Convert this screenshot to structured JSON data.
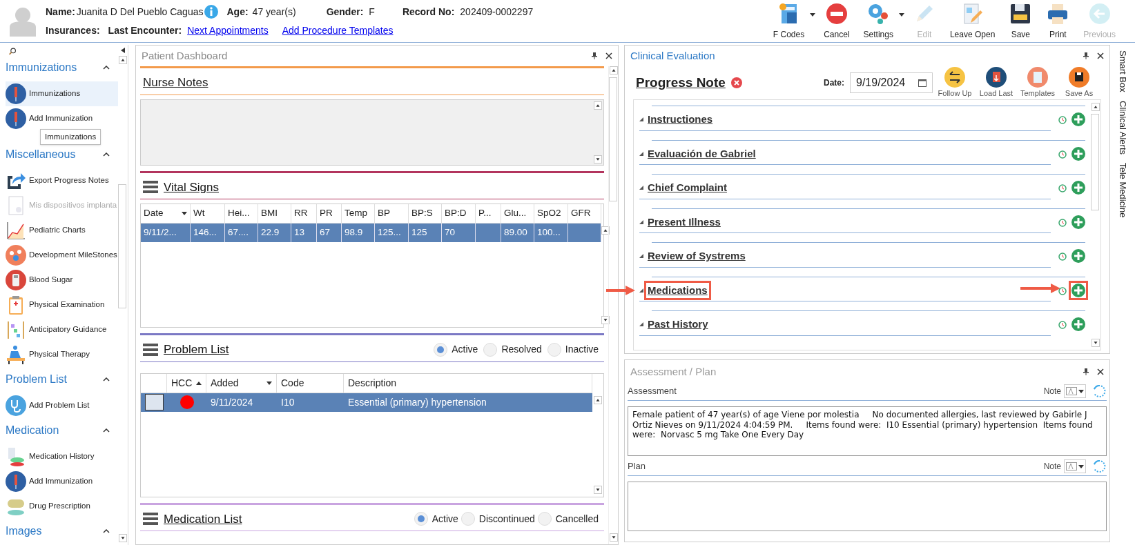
{
  "patient": {
    "name_label": "Name:",
    "name": "Juanita D Del Pueblo Caguas",
    "age_label": "Age:",
    "age": "47 year(s)",
    "gender_label": "Gender:",
    "gender": "F",
    "record_label": "Record No:",
    "record": "202409-0002297",
    "insurances_label": "Insurances:",
    "last_encounter_label": "Last Encounter:",
    "links": [
      "Next Appointments",
      "Add Procedure Templates"
    ]
  },
  "toolbar": [
    {
      "label": "F Codes",
      "disabled": false,
      "dropdown": true
    },
    {
      "label": "Cancel",
      "disabled": false,
      "dropdown": false
    },
    {
      "label": "Settings",
      "disabled": false,
      "dropdown": true
    },
    {
      "label": "Edit",
      "disabled": true,
      "dropdown": false
    },
    {
      "label": "Leave Open",
      "disabled": false,
      "dropdown": false
    },
    {
      "label": "Save",
      "disabled": false,
      "dropdown": false
    },
    {
      "label": "Print",
      "disabled": false,
      "dropdown": false
    },
    {
      "label": "Previous",
      "disabled": true,
      "dropdown": false
    }
  ],
  "sidebar": {
    "groups": [
      {
        "title": "Immunizations",
        "expanded": true,
        "items": [
          {
            "label": "Immunizations",
            "selected": true,
            "disabled": false
          },
          {
            "label": "Add Immunization",
            "selected": false,
            "disabled": false
          }
        ]
      },
      {
        "title": "Miscellaneous",
        "expanded": true,
        "items": [
          {
            "label": "Export Progress Notes",
            "selected": false,
            "disabled": false
          },
          {
            "label": "Mis dispositivos implanta",
            "selected": false,
            "disabled": true
          },
          {
            "label": "Pediatric Charts",
            "selected": false,
            "disabled": false
          },
          {
            "label": "Development MileStones",
            "selected": false,
            "disabled": false
          },
          {
            "label": "Blood Sugar",
            "selected": false,
            "disabled": false
          },
          {
            "label": "Physical Examination",
            "selected": false,
            "disabled": false
          },
          {
            "label": "Anticipatory Guidance",
            "selected": false,
            "disabled": false
          },
          {
            "label": "Physical Therapy",
            "selected": false,
            "disabled": false
          }
        ]
      },
      {
        "title": "Problem List",
        "expanded": true,
        "items": [
          {
            "label": "Add Problem List",
            "selected": false,
            "disabled": false
          }
        ]
      },
      {
        "title": "Medication",
        "expanded": true,
        "items": [
          {
            "label": "Medication History",
            "selected": false,
            "disabled": false
          },
          {
            "label": "Add Immunization",
            "selected": false,
            "disabled": false
          },
          {
            "label": "Drug Prescription",
            "selected": false,
            "disabled": false
          }
        ]
      },
      {
        "title": "Images",
        "expanded": true
      }
    ],
    "tooltip": "Immunizations"
  },
  "dashboard": {
    "title": "Patient Dashboard",
    "nurse_notes": {
      "title": "Nurse Notes"
    },
    "vital_signs": {
      "title": "Vital Signs",
      "columns": [
        "Date",
        "Wt",
        "Hei...",
        "BMI",
        "RR",
        "PR",
        "Temp",
        "BP",
        "BP:S",
        "BP:D",
        "P...",
        "Glu...",
        "SpO2",
        "GFR"
      ],
      "rows": [
        {
          "selected": true,
          "cells": [
            "9/11/2...",
            "146...",
            "67....",
            "22.9",
            "13",
            "67",
            "98.9",
            "125...",
            "125",
            "70",
            "",
            "89.00",
            "100...",
            ""
          ]
        }
      ]
    },
    "problem_list": {
      "title": "Problem List",
      "filters": [
        {
          "label": "Active",
          "selected": true
        },
        {
          "label": "Resolved",
          "selected": false
        },
        {
          "label": "Inactive",
          "selected": false
        }
      ],
      "columns": [
        "HCC",
        "Added",
        "Code",
        "Description"
      ],
      "rows": [
        {
          "selected": true,
          "color": "#ff0000",
          "added": "9/11/2024",
          "code": "I10",
          "description": "Essential (primary) hypertension"
        }
      ]
    },
    "medication_list": {
      "title": "Medication List",
      "filters": [
        {
          "label": "Active",
          "selected": true
        },
        {
          "label": "Discontinued",
          "selected": false
        },
        {
          "label": "Cancelled",
          "selected": false
        }
      ]
    }
  },
  "clinical_evaluation": {
    "title": "Clinical Evaluation",
    "note_title": "Progress Note",
    "date_label": "Date:",
    "date": "9/19/2024",
    "actions": [
      "Follow Up",
      "Load Last",
      "Templates",
      "Save As"
    ],
    "sections": [
      {
        "title": "Instructiones",
        "highlighted": false
      },
      {
        "title": "Evaluación de Gabriel",
        "highlighted": false
      },
      {
        "title": "Chief Complaint",
        "highlighted": false
      },
      {
        "title": "Present Illness",
        "highlighted": false
      },
      {
        "title": "Review of Systrems",
        "highlighted": false
      },
      {
        "title": "Medications",
        "highlighted": true
      },
      {
        "title": "Past History",
        "highlighted": false
      }
    ]
  },
  "assessment_plan": {
    "title": "Assessment / Plan",
    "assessment": {
      "label": "Assessment",
      "note_label": "Note",
      "text": "Female patient of 47 year(s) of age Viene por molestia     No documented allergies, last reviewed by Gabirle J Ortiz Nieves on 9/11/2024 4:04:59 PM.     Items found were:  I10 Essential (primary) hypertension  Items found were:  Norvasc 5 mg Take One Every Day"
    },
    "plan": {
      "label": "Plan",
      "note_label": "Note"
    }
  },
  "side_tabs": [
    "Smart Box",
    "Clinical Alerts",
    "Tele Medicine"
  ]
}
